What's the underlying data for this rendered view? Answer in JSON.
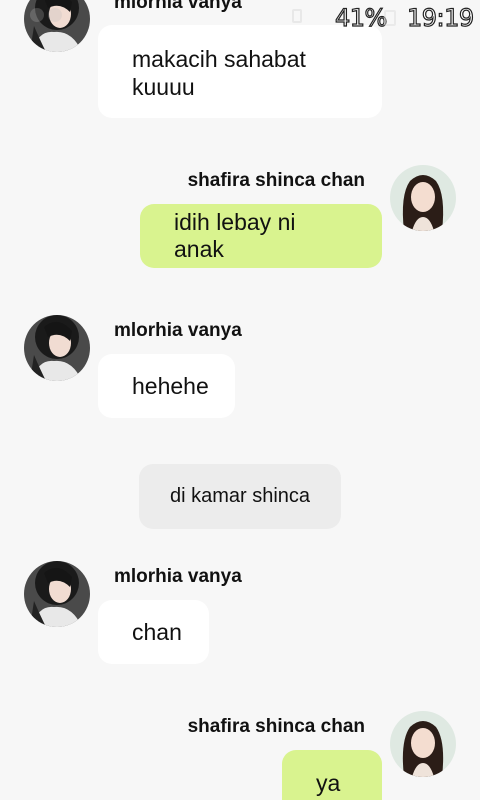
{
  "status_bar": {
    "battery": "41%",
    "time": "19:19"
  },
  "messages": [
    {
      "sender": "mlorhia  vanya",
      "text_lines": [
        "makacih sahabat",
        "kuuuu"
      ],
      "side": "left"
    },
    {
      "sender": "shafira shinca chan",
      "text": "idih lebay ni anak",
      "side": "right"
    },
    {
      "sender": "mlorhia  vanya",
      "text": "hehehe",
      "side": "left"
    },
    {
      "system": "di kamar shinca"
    },
    {
      "sender": "mlorhia  vanya",
      "text": "chan",
      "side": "left"
    },
    {
      "sender": "shafira shinca chan",
      "text": "ya ?",
      "side": "right"
    }
  ],
  "colors": {
    "background": "#f7f7f7",
    "incoming_bubble": "#ffffff",
    "outgoing_bubble": "#d9f38f",
    "system_bubble": "#ececec"
  }
}
